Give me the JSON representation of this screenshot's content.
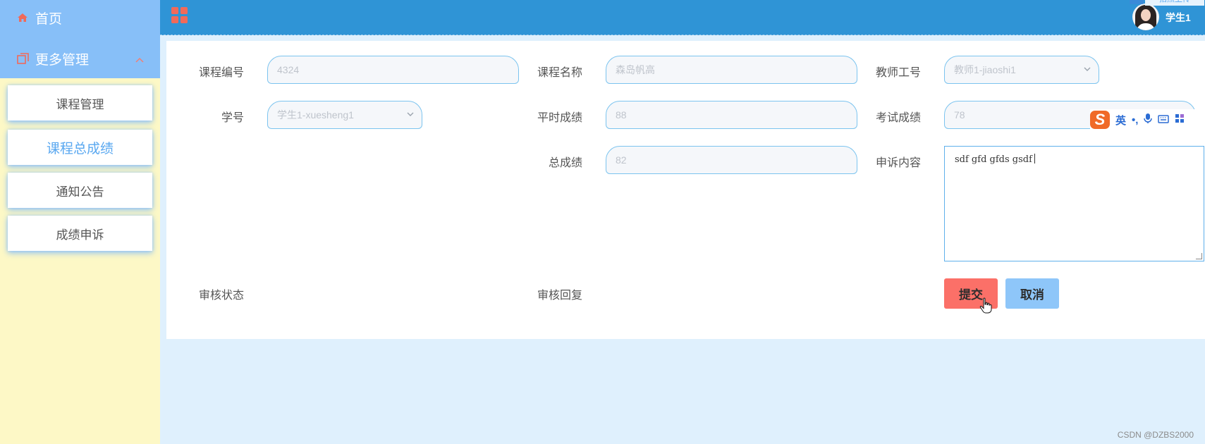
{
  "sidebar": {
    "home_label": "首页",
    "more_label": "更多管理",
    "items": [
      {
        "label": "课程管理"
      },
      {
        "label": "课程总成绩"
      },
      {
        "label": "通知公告"
      },
      {
        "label": "成绩申诉"
      }
    ]
  },
  "header": {
    "username": "学生1",
    "upload_tag": "拍照上传"
  },
  "form": {
    "course_no_label": "课程编号",
    "course_no_value": "4324",
    "course_name_label": "课程名称",
    "course_name_value": "森岛帆高",
    "teacher_no_label": "教师工号",
    "teacher_no_value": "教师1-jiaoshi1",
    "student_no_label": "学号",
    "student_no_value": "学生1-xuesheng1",
    "usual_score_label": "平时成绩",
    "usual_score_value": "88",
    "exam_score_label": "考试成绩",
    "exam_score_value": "78",
    "total_score_label": "总成绩",
    "total_score_value": "82",
    "appeal_label": "申诉内容",
    "appeal_value": "sdf gfd gfds gsdf",
    "review_status_label": "审核状态",
    "review_reply_label": "审核回复",
    "submit_label": "提交",
    "cancel_label": "取消"
  },
  "ime": {
    "logo": "S",
    "lang": "英",
    "punct": "•,"
  },
  "watermark": "CSDN @DZBS2000",
  "colors": {
    "sidebar_top": "#87bff8",
    "sidebar_bg": "#fdf8c6",
    "topbar": "#2f94d6",
    "submit": "#fb7068",
    "cancel": "#8ec6f9",
    "active_menu_text": "#5aa8f0"
  }
}
